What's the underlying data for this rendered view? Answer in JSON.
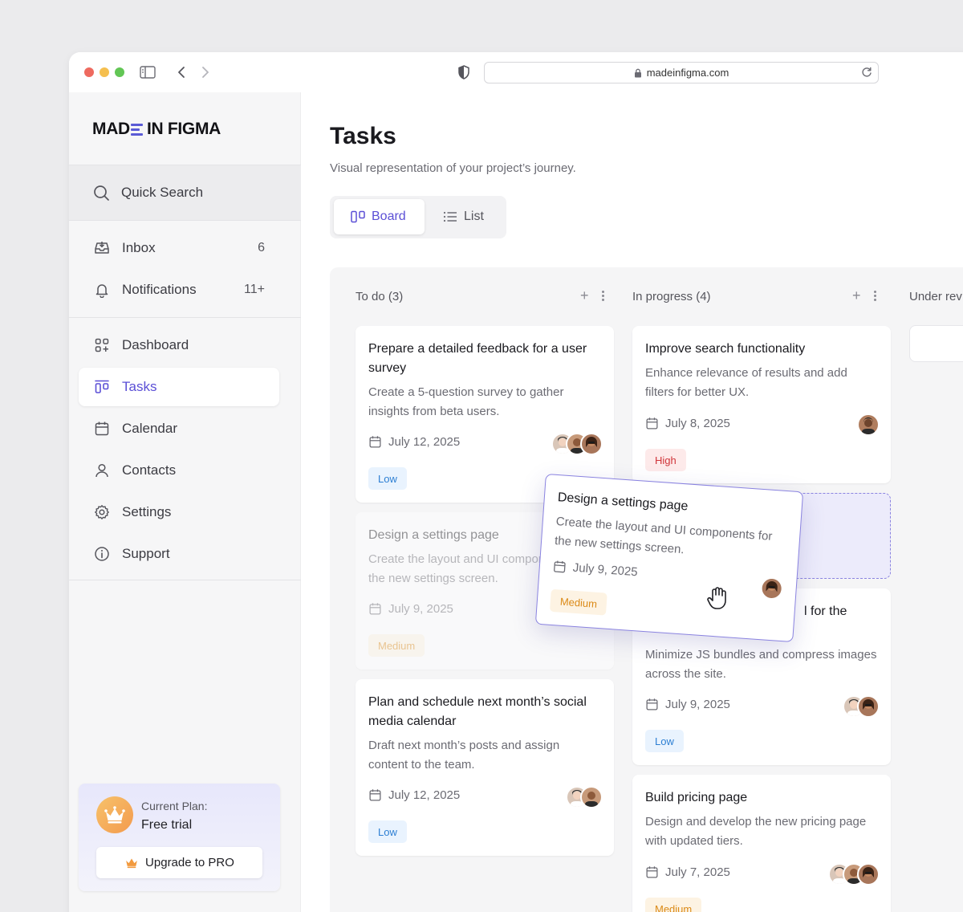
{
  "browser": {
    "url": "madeinfigma.com"
  },
  "brand": {
    "logo_left": "MAD",
    "logo_right": "IN FIGMA",
    "accent": "#5b4fd6"
  },
  "sidebar": {
    "search_label": "Quick Search",
    "top_items": [
      {
        "label": "Inbox",
        "count": "6",
        "icon": "inbox-icon"
      },
      {
        "label": "Notifications",
        "count": "11+",
        "icon": "bell-icon"
      }
    ],
    "items": [
      {
        "label": "Dashboard",
        "icon": "dashboard-icon"
      },
      {
        "label": "Tasks",
        "icon": "tasks-icon",
        "active": true
      },
      {
        "label": "Calendar",
        "icon": "calendar-icon"
      },
      {
        "label": "Contacts",
        "icon": "user-icon"
      },
      {
        "label": "Settings",
        "icon": "gear-icon"
      },
      {
        "label": "Support",
        "icon": "info-icon"
      }
    ],
    "plan": {
      "label": "Current Plan:",
      "name": "Free trial",
      "upgrade_label": "Upgrade to PRO"
    }
  },
  "main": {
    "title": "Tasks",
    "subtitle": "Visual representation of your project’s journey.",
    "views": {
      "board": "Board",
      "list": "List"
    }
  },
  "board": {
    "columns": [
      {
        "title": "To do (3)",
        "cards": [
          {
            "title": "Prepare a detailed feedback for a user survey",
            "desc": "Create a 5-question survey to gather insights from beta users.",
            "date": "July 12, 2025",
            "priority": "Low"
          },
          {
            "title": "Design a settings page",
            "desc": "Create the layout and UI components for the new settings screen.",
            "date": "July 9, 2025",
            "priority": "Medium"
          },
          {
            "title": "Plan and schedule next month’s social media calendar",
            "desc": "Draft next month’s posts and assign content to the team.",
            "date": "July 12, 2025",
            "priority": "Low"
          }
        ]
      },
      {
        "title": "In progress (4)",
        "cards": [
          {
            "title": "Improve search functionality",
            "desc": "Enhance relevance of results and add filters for better UX.",
            "date": "July 8, 2025",
            "priority": "High"
          },
          {
            "title_fragment": "l for the",
            "desc": "Minimize JS bundles and compress images across the site.",
            "date": "July 9, 2025",
            "priority": "Low"
          },
          {
            "title": "Build pricing page",
            "desc": "Design and develop the new pricing page with updated tiers.",
            "date": "July 7, 2025",
            "priority": "Medium"
          }
        ]
      },
      {
        "title": "Under rev"
      }
    ],
    "dragging": {
      "title": "Design a settings page",
      "desc": "Create the layout and UI components for the new settings screen.",
      "date": "July 9, 2025",
      "priority": "Medium"
    }
  }
}
